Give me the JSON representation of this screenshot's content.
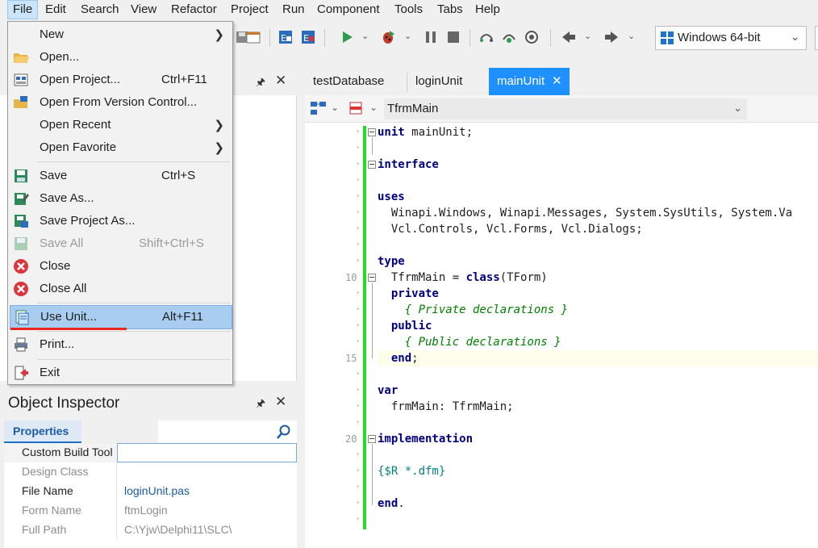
{
  "menubar": {
    "items": [
      "File",
      "Edit",
      "Search",
      "View",
      "Refactor",
      "Project",
      "Run",
      "Component",
      "Tools",
      "Tabs",
      "Help"
    ]
  },
  "toolbar": {
    "platform": "Windows 64-bit"
  },
  "file_menu": {
    "items": [
      {
        "label": "New",
        "shortcut": "",
        "submenu": true
      },
      {
        "label": "Open...",
        "shortcut": ""
      },
      {
        "label": "Open Project...",
        "shortcut": "Ctrl+F11"
      },
      {
        "label": "Open From Version Control...",
        "shortcut": ""
      },
      {
        "label": "Open Recent",
        "shortcut": "",
        "submenu": true
      },
      {
        "label": "Open Favorite",
        "shortcut": "",
        "submenu": true
      },
      {
        "label": "Save",
        "shortcut": "Ctrl+S"
      },
      {
        "label": "Save As...",
        "shortcut": ""
      },
      {
        "label": "Save Project As...",
        "shortcut": ""
      },
      {
        "label": "Save All",
        "shortcut": "Shift+Ctrl+S",
        "disabled": true
      },
      {
        "label": "Close",
        "shortcut": ""
      },
      {
        "label": "Close All",
        "shortcut": ""
      },
      {
        "label": "Use Unit...",
        "shortcut": "Alt+F11",
        "highlighted": true
      },
      {
        "label": "Print...",
        "shortcut": ""
      },
      {
        "label": "Exit",
        "shortcut": ""
      }
    ]
  },
  "object_inspector": {
    "title": "Object Inspector",
    "tab": "Properties",
    "rows": [
      {
        "name": "Custom Build Tool",
        "value": ""
      },
      {
        "name": "Design Class",
        "value": ""
      },
      {
        "name": "File Name",
        "value": "loginUnit.pas"
      },
      {
        "name": "Form Name",
        "value": "ftmLogin"
      },
      {
        "name": "Full Path",
        "value": "C:\\Yjw\\Delphi11\\SLC\\"
      }
    ]
  },
  "editor": {
    "tabs": [
      "testDatabase",
      "loginUnit",
      "mainUnit"
    ],
    "active_tab": "mainUnit",
    "nav_class": "TfrmMain",
    "line_numbers": [
      "10",
      "15",
      "20"
    ],
    "code": {
      "l1_kw": "unit",
      "l1_rest": " mainUnit;",
      "l3_kw": "interface",
      "l5_kw": "uses",
      "l6": "  Winapi.Windows, Winapi.Messages, System.SysUtils, System.Va",
      "l7": "  Vcl.Controls, Vcl.Forms, Vcl.Dialogs;",
      "l9_kw": "type",
      "l10_a": "  TfrmMain = ",
      "l10_kw": "class",
      "l10_b": "(TForm)",
      "l11_kw": "private",
      "l12_cm": "{ Private declarations }",
      "l13_kw": "public",
      "l14_cm": "{ Public declarations }",
      "l15_kw": "end",
      "l15_rest": ";",
      "l17_kw": "var",
      "l18": "  frmMain: TfrmMain;",
      "l20_kw": "implementation",
      "l22_dr": "{$R *.dfm}",
      "l24_kw": "end",
      "l24_rest": "."
    }
  },
  "colors": {
    "accent": "#1e90ff",
    "change_bar": "#22dd22",
    "annotation_underline": "#e8281e"
  }
}
